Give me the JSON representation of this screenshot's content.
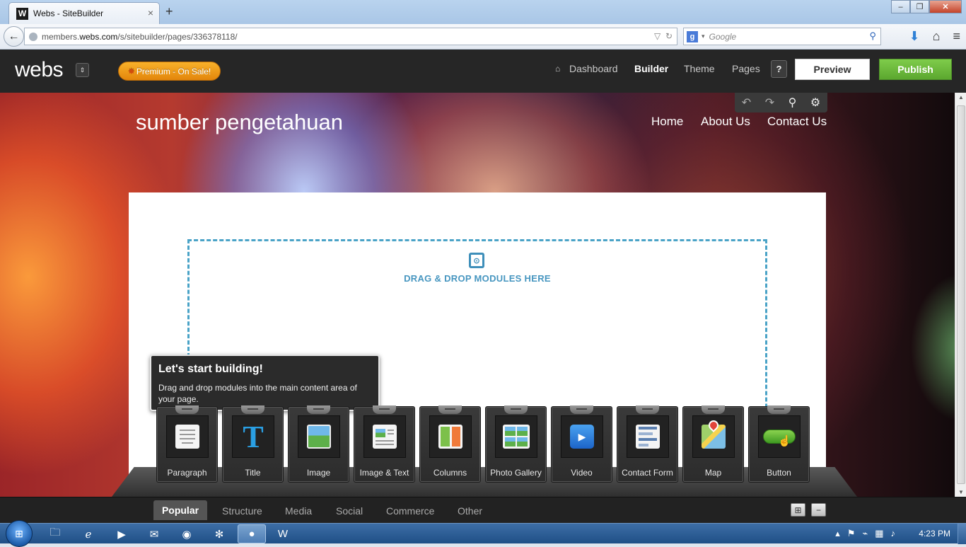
{
  "browser": {
    "tab_title": "Webs - SiteBuilder",
    "favicon_letter": "W",
    "new_tab": "+",
    "url_prefix": "members.",
    "url_domain": "webs.com",
    "url_path": "/s/sitebuilder/pages/336378118/",
    "search_placeholder": "Google",
    "window_buttons": [
      "minimize",
      "restore",
      "close"
    ]
  },
  "app": {
    "logo": "webs",
    "premium_label": "Premium - On Sale!",
    "nav": {
      "dashboard": "Dashboard",
      "builder": "Builder",
      "theme": "Theme",
      "pages": "Pages"
    },
    "help": "?",
    "preview": "Preview",
    "publish": "Publish",
    "colors": {
      "header_bg": "#262626",
      "publish_green": "#6dbb3f",
      "premium_orange": "#f0a01e"
    }
  },
  "site": {
    "title": "sumber pengetahuan",
    "nav": [
      "Home",
      "About Us",
      "Contact Us"
    ],
    "dropzone_text": "DRAG & DROP MODULES HERE"
  },
  "tooltip": {
    "title": "Let's start building!",
    "body": "Drag and drop modules into the main content area of your page."
  },
  "modules": [
    {
      "label": "Paragraph",
      "icon": "paragraph-icon"
    },
    {
      "label": "Title",
      "icon": "title-icon"
    },
    {
      "label": "Image",
      "icon": "image-icon"
    },
    {
      "label": "Image & Text",
      "icon": "image-text-icon"
    },
    {
      "label": "Columns",
      "icon": "columns-icon"
    },
    {
      "label": "Photo Gallery",
      "icon": "photo-gallery-icon"
    },
    {
      "label": "Video",
      "icon": "video-icon"
    },
    {
      "label": "Contact Form",
      "icon": "contact-form-icon"
    },
    {
      "label": "Map",
      "icon": "map-icon"
    },
    {
      "label": "Button",
      "icon": "button-icon"
    }
  ],
  "categories": {
    "popular": "Popular",
    "structure": "Structure",
    "media": "Media",
    "social": "Social",
    "commerce": "Commerce",
    "other": "Other"
  },
  "taskbar": {
    "clock": "4:23 PM"
  }
}
